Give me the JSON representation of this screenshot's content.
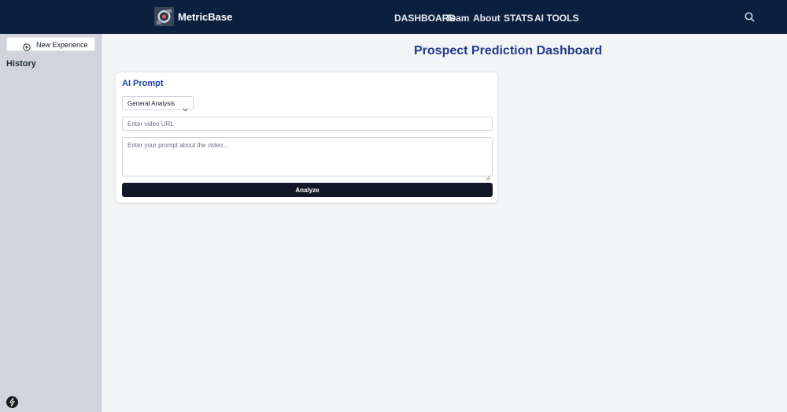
{
  "header": {
    "brand": "MetricBase",
    "nav": [
      {
        "label": "DASHBOARD"
      },
      {
        "label": "Team"
      },
      {
        "label": "About"
      },
      {
        "label": "STATS"
      },
      {
        "label": "AI TOOLS"
      }
    ]
  },
  "sidebar": {
    "new_experience_label": "New Experience",
    "history_label": "History"
  },
  "main": {
    "page_title": "Prospect Prediction Dashboard",
    "card": {
      "title": "AI Prompt",
      "analysis_type": "General Analysis",
      "url_placeholder": "Enter video URL",
      "url_value": "",
      "prompt_placeholder": "Enter your prompt about the video...",
      "prompt_value": "",
      "analyze_label": "Analyze"
    }
  },
  "colors": {
    "topbar": "#0b1f3f",
    "sidebar": "#d1d5db",
    "title_accent": "#1e3a8a",
    "button_bg": "#111827"
  },
  "icons": {
    "logo": "metricbase-logo-icon",
    "search": "search-icon",
    "new_experience": "plus-circle-icon",
    "dropdown": "chevron-down-icon",
    "assistant": "bolt-icon"
  }
}
